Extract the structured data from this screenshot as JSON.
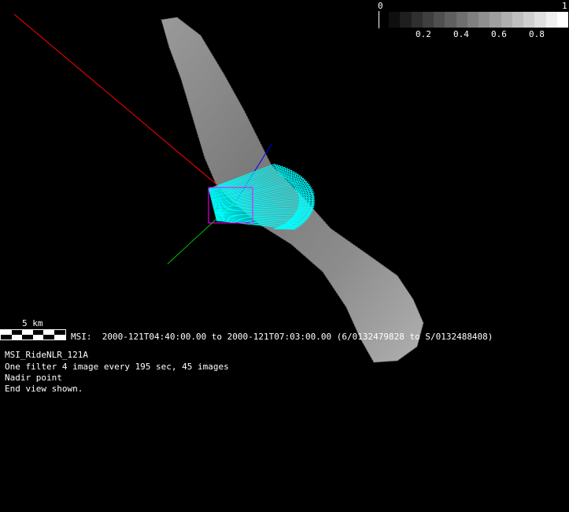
{
  "colorbar": {
    "min_label": "0",
    "max_label": "1",
    "tick_labels": [
      "0.2",
      "0.4",
      "0.6",
      "0.8"
    ],
    "steps": 16
  },
  "scale_bar": {
    "label": "5 km"
  },
  "observation_line": "MSI:  2000-121T04:40:00.00 to 2000-121T07:03:00.00 (6/0132479828 to S/0132488408)",
  "info": {
    "sequence": "MSI_RideNLR_121A",
    "description": "One filter 4 image every 195 sec, 45 images",
    "point": "Nadir point",
    "view": "End view shown."
  },
  "colors": {
    "footprints": "#00ffff",
    "x_axis": "#ff0000",
    "y_axis": "#00c000",
    "z_axis": "#0000ff",
    "background": "#000000"
  }
}
